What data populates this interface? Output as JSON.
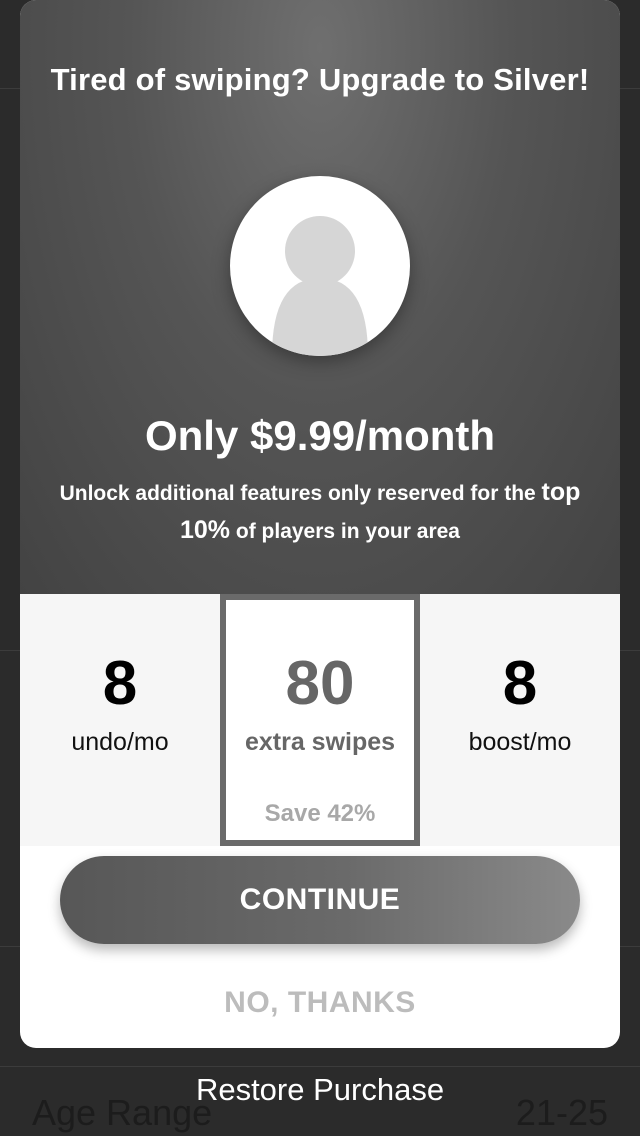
{
  "modal": {
    "title": "Tired of swiping? Upgrade to Silver!",
    "price": "Only $9.99/month",
    "subtitle_pre": "Unlock additional features only reserved for the ",
    "subtitle_highlight_1": "top",
    "subtitle_highlight_2": "10%",
    "subtitle_post": " of players in your area",
    "avatar_icon": "user-silhouette-icon",
    "plans": [
      {
        "count": "8",
        "unit": "undo/mo",
        "selected": false
      },
      {
        "count": "80",
        "unit": "extra swipes",
        "save": "Save 42%",
        "selected": true
      },
      {
        "count": "8",
        "unit": "boost/mo",
        "selected": false
      }
    ],
    "continue_label": "CONTINUE",
    "no_thanks_label": "NO, THANKS"
  },
  "background": {
    "restore_label": "Restore Purchase",
    "row_label": "Age Range",
    "row_value": "21-25"
  },
  "colors": {
    "hero_dark": "#434343",
    "hero_light": "#6f6f6f",
    "selected_border": "#6a6a6a",
    "button": "#6a6a6a"
  }
}
